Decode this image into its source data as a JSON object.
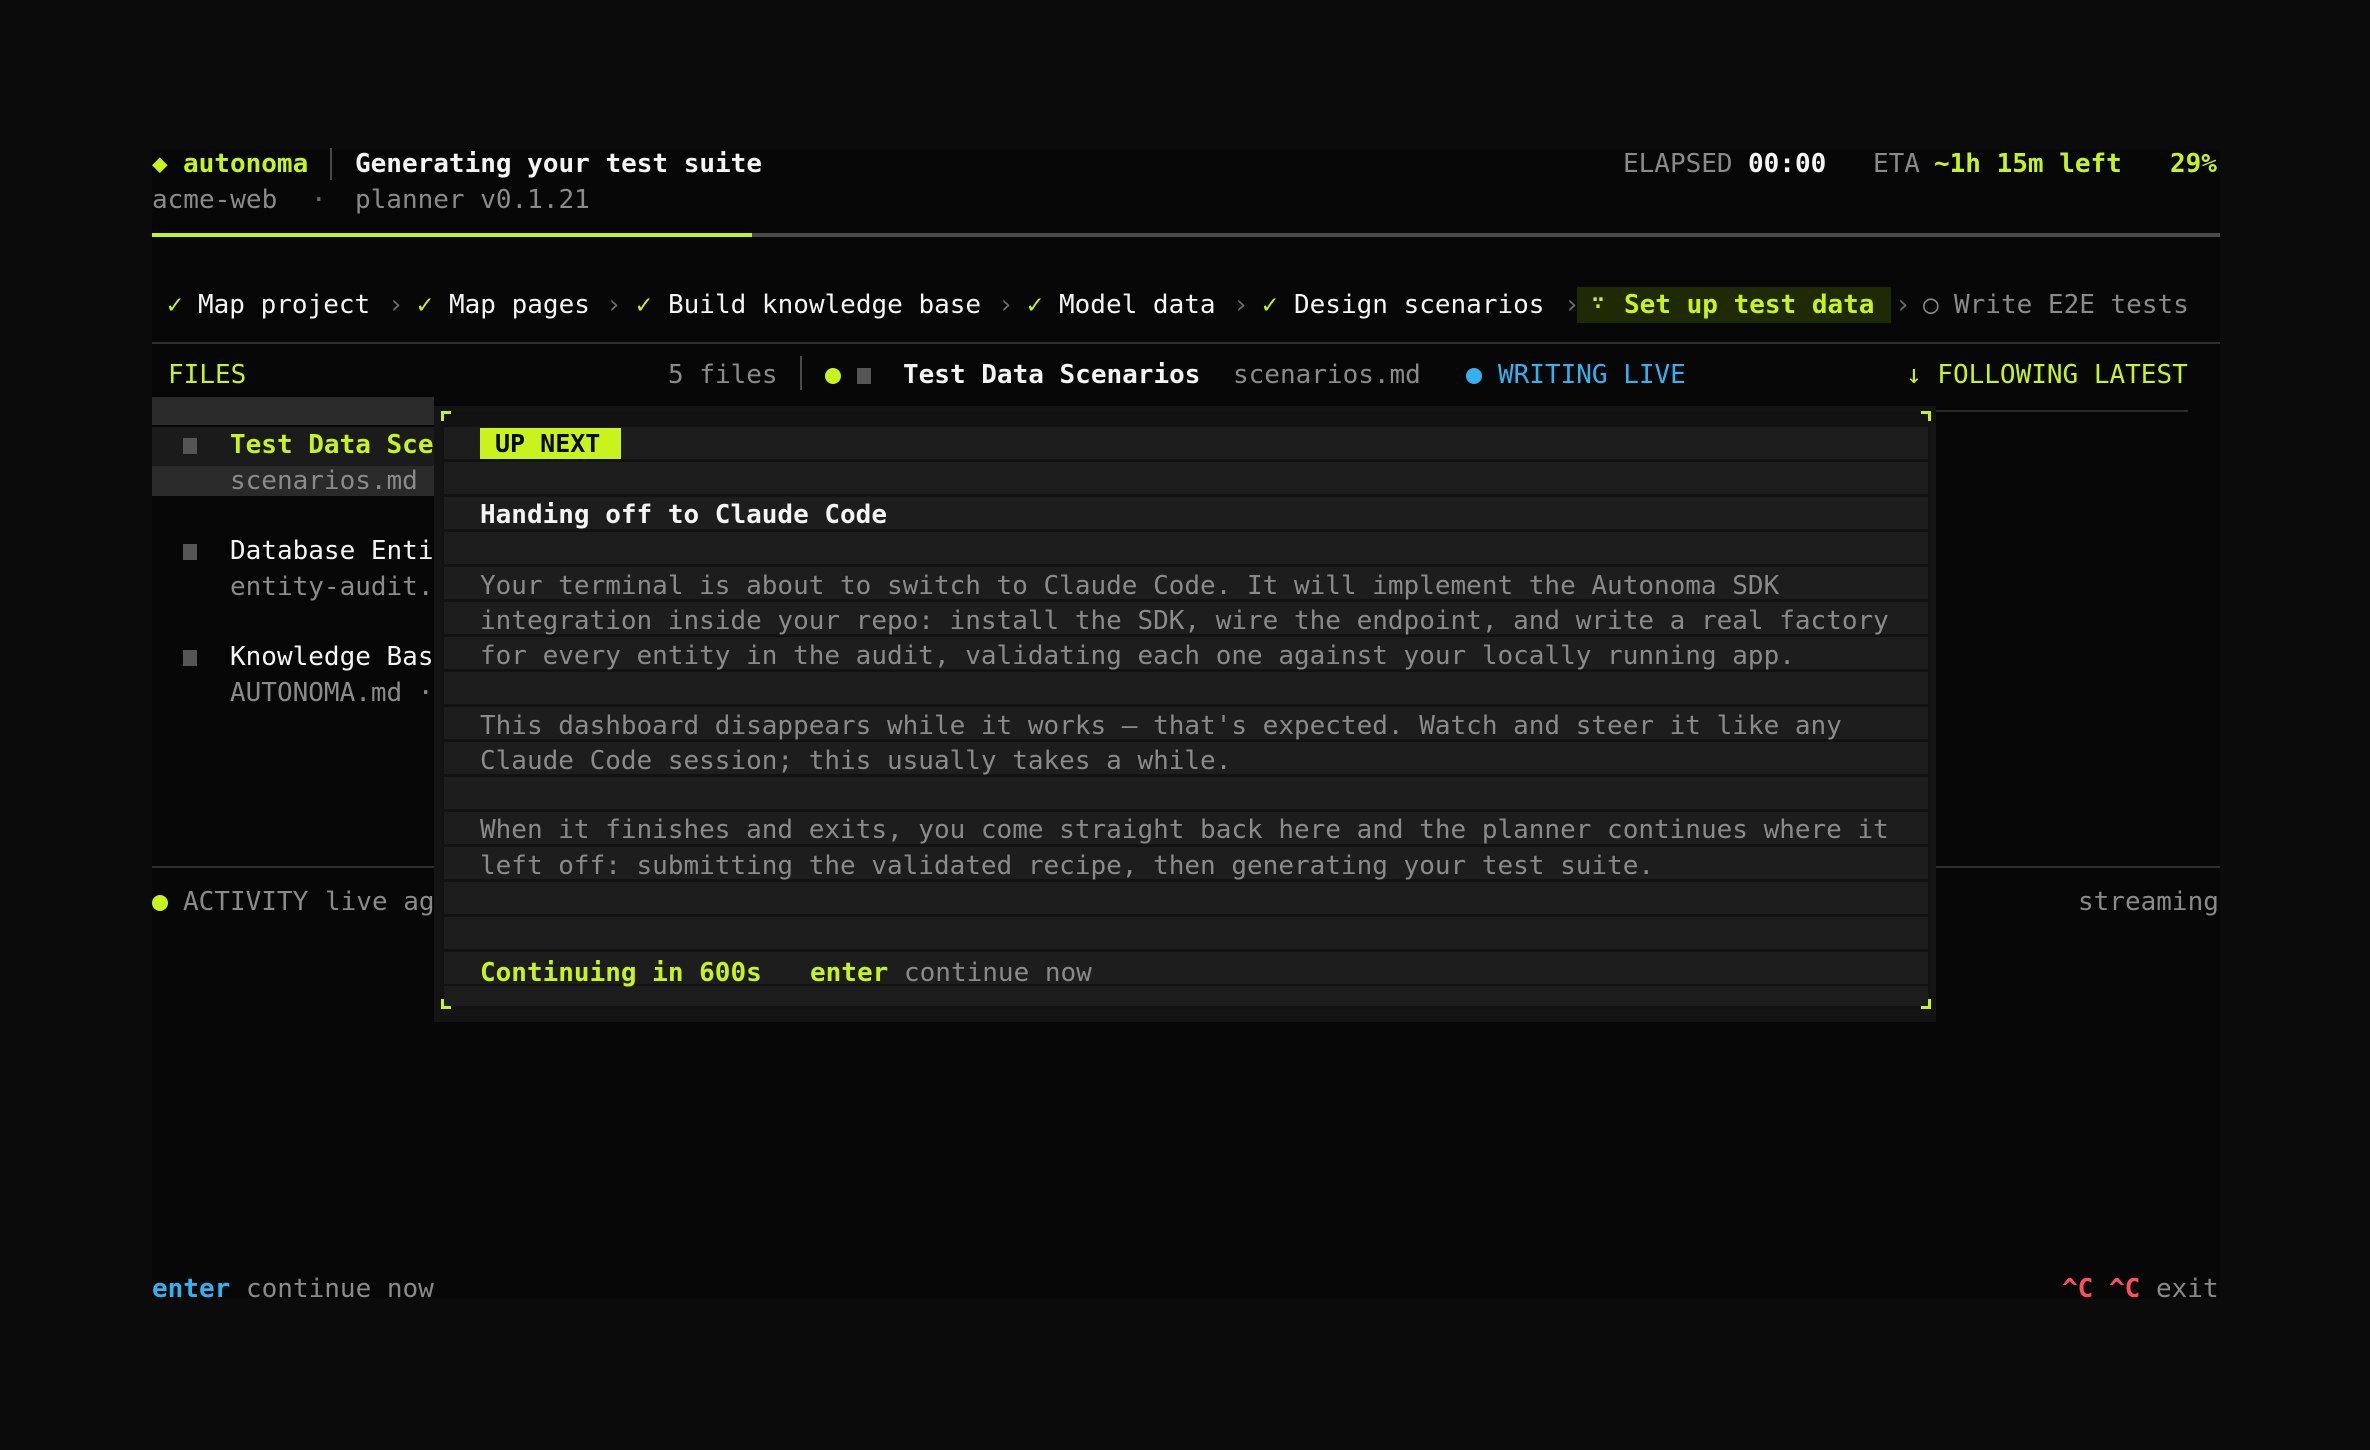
{
  "header": {
    "brand_glyph": "◆",
    "brand": "autonoma",
    "title": "Generating your test suite",
    "project": "acme-web",
    "dot_sep": "·",
    "version": "planner v0.1.21",
    "elapsed_label": "ELAPSED",
    "elapsed_value": "00:00",
    "eta_label": "ETA",
    "eta_value": "~1h 15m left",
    "percent": "29%",
    "progress_fraction": 0.29
  },
  "steps": [
    {
      "mark": "✓",
      "label": "Map project"
    },
    {
      "mark": "✓",
      "label": "Map pages"
    },
    {
      "mark": "✓",
      "label": "Build knowledge base"
    },
    {
      "mark": "✓",
      "label": "Model data"
    },
    {
      "mark": "✓",
      "label": "Design scenarios"
    },
    {
      "mark": "∵",
      "label": "Set up test data"
    },
    {
      "mark": "○",
      "label": "Write E2E tests"
    }
  ],
  "step_separator": "›",
  "files": {
    "title": "FILES",
    "count": "5 files",
    "items": [
      {
        "name": "Test Data Sce",
        "sub": "scenarios.md"
      },
      {
        "name": "Database Enti",
        "sub": "entity-audit."
      },
      {
        "name": "Knowledge Bas",
        "sub": "AUTONOMA.md ·"
      }
    ]
  },
  "doc": {
    "title": "Test Data Scenarios",
    "filename": "scenarios.md",
    "status": "WRITING LIVE",
    "follow": "↓ FOLLOWING LATEST"
  },
  "activity": {
    "label": "ACTIVITY",
    "live": "live ag",
    "streaming": "streaming"
  },
  "modal": {
    "badge": "UP NEXT",
    "title": "Handing off to Claude Code",
    "p1": [
      "Your terminal is about to switch to Claude Code. It will implement the Autonoma SDK",
      "integration inside your repo: install the SDK, wire the endpoint, and write a real factory",
      "for every entity in the audit, validating each one against your locally running app."
    ],
    "p2": [
      "This dashboard disappears while it works — that's expected. Watch and steer it like any",
      "Claude Code session; this usually takes a while."
    ],
    "p3": [
      "When it finishes and exits, you come straight back here and the planner continues where it",
      "left off: submitting the validated recipe, then generating your test suite."
    ],
    "countdown": "Continuing in 600s",
    "key": "enter",
    "key_action": "continue now"
  },
  "footer": {
    "key": "enter",
    "action": "continue now",
    "exit_keys": "^C ^C",
    "exit_label": "exit"
  },
  "colors": {
    "accent": "#c8f31d",
    "live": "#33b2ef",
    "danger": "#ff4f5e",
    "background": "#0b0b0b"
  }
}
